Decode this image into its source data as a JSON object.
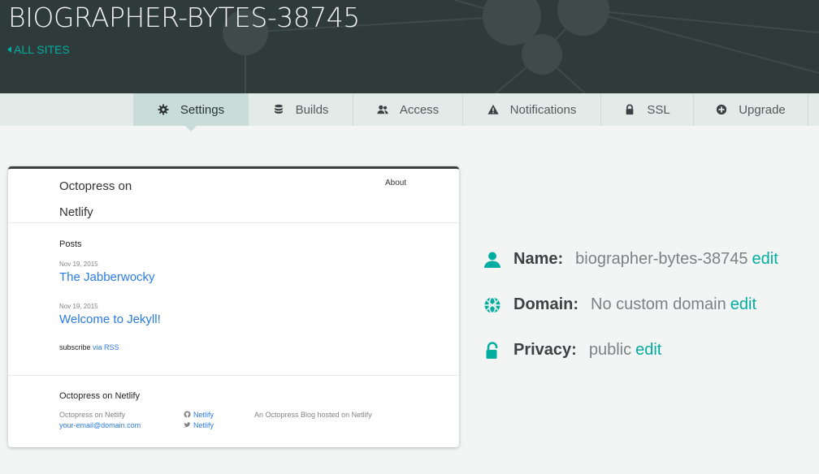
{
  "header": {
    "site_name": "BIOGRAPHER-BYTES-38745",
    "back_link": "ALL SITES"
  },
  "tabs": [
    {
      "label": "Settings",
      "icon": "gear-icon",
      "active": true
    },
    {
      "label": "Builds",
      "icon": "database-icon"
    },
    {
      "label": "Access",
      "icon": "users-icon"
    },
    {
      "label": "Notifications",
      "icon": "warning-icon"
    },
    {
      "label": "SSL",
      "icon": "lock-icon"
    },
    {
      "label": "Upgrade",
      "icon": "plus-circle-icon"
    }
  ],
  "preview": {
    "brand": "Octopress on Netlify",
    "nav_about": "About",
    "posts_heading": "Posts",
    "posts": [
      {
        "date": "Nov 19, 2015",
        "title": "The Jabberwocky"
      },
      {
        "date": "Nov 19, 2015",
        "title": "Welcome to Jekyll!"
      }
    ],
    "subscribe_text": "subscribe",
    "subscribe_link": "via RSS",
    "footer": {
      "title": "Octopress on Netlify",
      "author": "Octopress on Netlify",
      "email": "your-email@domain.com",
      "github": "Netlify",
      "twitter": "Netlify",
      "description": "An Octopress Blog hosted on Netlify"
    }
  },
  "info": {
    "name_label": "Name:",
    "name_value": "biographer-bytes-38745",
    "domain_label": "Domain:",
    "domain_value": "No custom domain",
    "privacy_label": "Privacy:",
    "privacy_value": "public",
    "edit_label": "edit"
  },
  "colors": {
    "accent": "#00ad9f",
    "header_bg": "#2f3a3b",
    "tab_bg": "#e3ebe9",
    "tab_active_bg": "#c9dcd8",
    "link_blue": "#2a7ae2"
  }
}
